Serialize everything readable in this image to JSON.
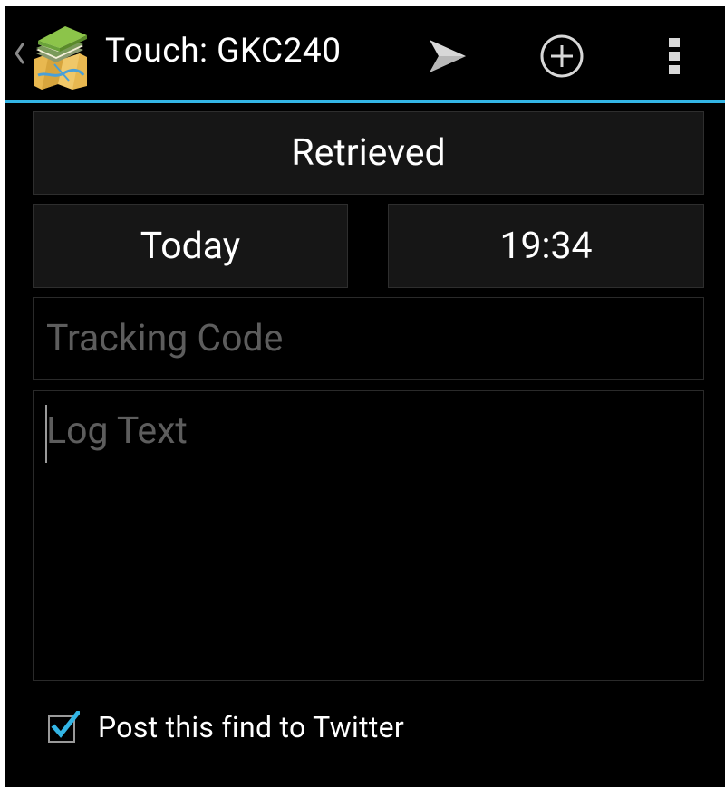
{
  "colors": {
    "background": "#000000",
    "accent": "#33b5e5",
    "button_bg": "#161616",
    "hint_text": "#5d5d5d",
    "text": "#ffffff"
  },
  "action_bar": {
    "title": "Touch: GKC240",
    "up_icon": "chevron-left-icon",
    "app_icon": "map-book-icon",
    "actions": [
      {
        "name": "send",
        "icon": "send-icon"
      },
      {
        "name": "add",
        "icon": "add-circle-icon"
      },
      {
        "name": "overflow",
        "icon": "more-vert-icon"
      }
    ]
  },
  "form": {
    "log_type": "Retrieved",
    "date": "Today",
    "time": "19:34",
    "tracking_code": {
      "value": "",
      "placeholder": "Tracking Code"
    },
    "log_text": {
      "value": "",
      "placeholder": "Log Text"
    },
    "twitter_checkbox": {
      "checked": true,
      "label": "Post this find to Twitter"
    }
  }
}
